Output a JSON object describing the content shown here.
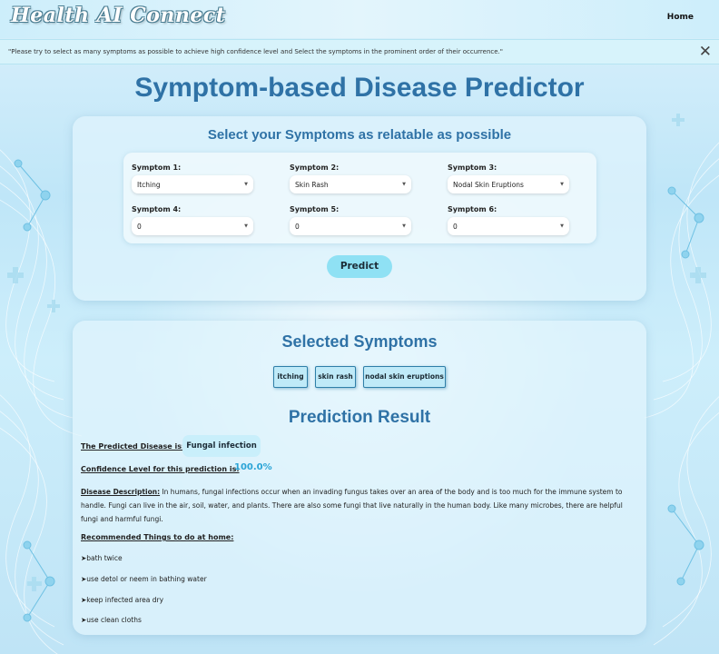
{
  "navbar": {
    "brand": "Health AI Connect",
    "home_link": "Home"
  },
  "alert": {
    "message": "\"Please try to select as many symptoms as possible to achieve high confidence level and Select the symptoms in the prominent order of their occurrence.\"",
    "close_glyph": "✕"
  },
  "page": {
    "title": "Symptom-based Disease Predictor"
  },
  "symptom_form": {
    "title": "Select your Symptoms as relatable as possible",
    "fields": [
      {
        "label": "Symptom 1:",
        "value": "Itching"
      },
      {
        "label": "Symptom 2:",
        "value": "Skin Rash"
      },
      {
        "label": "Symptom 3:",
        "value": "Nodal Skin Eruptions"
      },
      {
        "label": "Symptom 4:",
        "value": "0"
      },
      {
        "label": "Symptom 5:",
        "value": "0"
      },
      {
        "label": "Symptom 6:",
        "value": "0"
      }
    ],
    "predict_label": "Predict"
  },
  "selected": {
    "title": "Selected Symptoms",
    "chips": [
      "itching",
      "skin rash",
      "nodal skin eruptions"
    ]
  },
  "result": {
    "title": "Prediction Result",
    "disease_label": "The Predicted Disease is:",
    "disease_value": "Fungal infection",
    "confidence_label": "Confidence Level for this prediction is:",
    "confidence_value": "100.0%",
    "description_label": "Disease Description:",
    "description_text": " In humans, fungal infections occur when an invading fungus takes over an area of the body and is too much for the immune system to handle. Fungi can live in the air, soil, water, and plants. There are also some fungi that live naturally in the human body. Like many microbes, there are helpful fungi and harmful fungi.",
    "recommend_label": "Recommended Things to do at home:",
    "recommendations": [
      "➤bath twice",
      "➤use detol or neem in bathing water",
      "➤keep infected area dry",
      "➤use clean cloths"
    ]
  },
  "colors": {
    "accent": "#2f72a6",
    "predict_button": "#8fe1f4",
    "confidence": "#2aa4d6",
    "chip_bg": "#bfeaf8",
    "alert_bg": "#d7f3fb"
  }
}
